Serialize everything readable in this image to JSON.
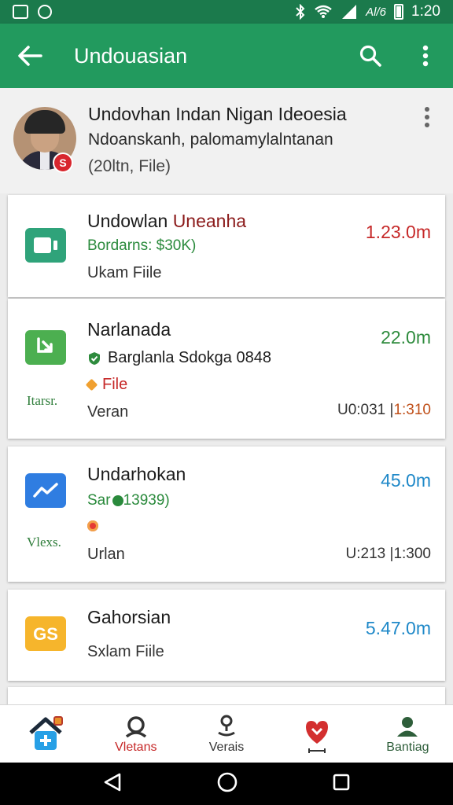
{
  "status_bar": {
    "time": "1:20",
    "signal_text": "Al/6"
  },
  "app_bar": {
    "title": "Undouasian"
  },
  "profile": {
    "name": "Undovhan Indan Nigan Ideoesia",
    "subtitle": "Ndoanskanh, palomamylalntanan",
    "meta": "(20ltn, File)",
    "badge": "S"
  },
  "cards": [
    {
      "title_prefix": "Undowlan ",
      "title_suffix": "Uneanha",
      "green_line": "Bordarns: $30K)",
      "line": "Ukam Fiile",
      "amount": "1.23.0m",
      "amount_color": "#c62828",
      "icon": "camera-icon",
      "icon_color": "#2fa37a"
    },
    {
      "title": "Narlanada",
      "verified_line": "Barglanla Sdokga 0848",
      "file_label": "File",
      "side_label": "Itarsr.",
      "line": "Veran",
      "time_black": "U0:031 |",
      "time_red": "1:310",
      "amount": "22.0m",
      "amount_color": "#2e8b3d",
      "icon": "download-icon",
      "icon_color": "#4caf50"
    },
    {
      "title": "Undarhokan",
      "green_prefix": "Sar",
      "green_suffix": " 13939)",
      "side_label": "Vlexs.",
      "line": "Urlan",
      "time_black": "U:213 |1:300",
      "amount": "45.0m",
      "amount_color": "#1e88c8",
      "icon": "trend-chart-icon",
      "icon_color": "#2f7de1"
    },
    {
      "title": "Gahorsian",
      "line": "Sxlam Fiile",
      "amount": "5.47.0m",
      "amount_color": "#1e88c8",
      "icon": "exchange-icon",
      "icon_color": "#f6b52c"
    }
  ],
  "bottom_nav": [
    {
      "label": "",
      "icon": "home-add-icon"
    },
    {
      "label": "Vletans",
      "icon": "person-icon",
      "color": "#c62828"
    },
    {
      "label": "Verais",
      "icon": "location-person-icon",
      "color": "#333333"
    },
    {
      "label": "",
      "icon": "heart-badge-icon",
      "color": "#d32f2f"
    },
    {
      "label": "Bantiag",
      "icon": "account-icon",
      "color": "#2e5e3a"
    }
  ]
}
